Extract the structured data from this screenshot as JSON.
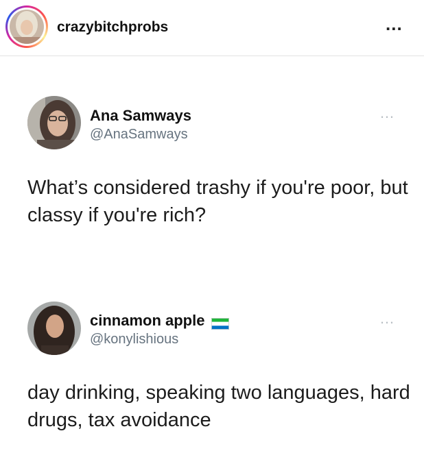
{
  "header": {
    "username": "crazybitchprobs",
    "more_icon": "ellipsis-horizontal-icon",
    "more_label": "..."
  },
  "tweets": [
    {
      "name": "Ana Samways",
      "handle": "@AnaSamways",
      "text": "What’s considered trashy if you're poor, but classy if you're rich?",
      "more_label": "…"
    },
    {
      "name": "cinnamon apple",
      "flag_icon": "sierra-leone-flag-icon",
      "handle": "@konylishious",
      "text": "day drinking, speaking two languages, hard drugs, tax avoidance",
      "more_label": "…"
    }
  ],
  "colors": {
    "handle": "#66737f",
    "divider": "#e2e2e2",
    "flag_green": "#1eb53a",
    "flag_white": "#ffffff",
    "flag_blue": "#0072c6"
  }
}
